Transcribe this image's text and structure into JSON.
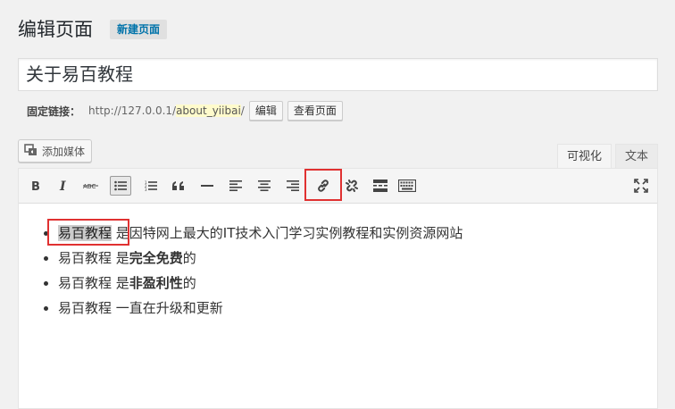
{
  "header": {
    "title": "编辑页面",
    "add_new": "新建页面"
  },
  "post": {
    "title": "关于易百教程"
  },
  "permalink": {
    "label": "固定链接：",
    "url_prefix": "http://127.0.0.1/",
    "slug": "about_yiibai",
    "slug_suffix": "/",
    "edit_label": "编辑",
    "view_label": "查看页面"
  },
  "media": {
    "add_media_label": "添加媒体"
  },
  "editor_tabs": {
    "visual": "可视化",
    "text": "文本"
  },
  "toolbar": {
    "icons": [
      "bold-icon",
      "italic-icon",
      "strikethrough-icon",
      "bulleted-list-icon",
      "numbered-list-icon",
      "blockquote-icon",
      "horizontal-line-icon",
      "align-left-icon",
      "align-center-icon",
      "align-right-icon",
      "insert-link-icon",
      "unlink-icon",
      "read-more-icon",
      "toolbar-toggle-icon",
      "fullscreen-icon"
    ]
  },
  "content": {
    "items": [
      {
        "highlight": "易百教程",
        "text": " 是因特网上最大的IT技术入门学习实例教程和实例资源网站"
      },
      {
        "prefix": "易百教程 是",
        "bold": "完全免费",
        "suffix": "的"
      },
      {
        "prefix": "易百教程 是",
        "bold": "非盈利性",
        "suffix": "的"
      },
      {
        "text": "易百教程 一直在升级和更新"
      }
    ]
  },
  "accent_colors": {
    "link": "#0073aa",
    "annotation": "#e03131"
  }
}
